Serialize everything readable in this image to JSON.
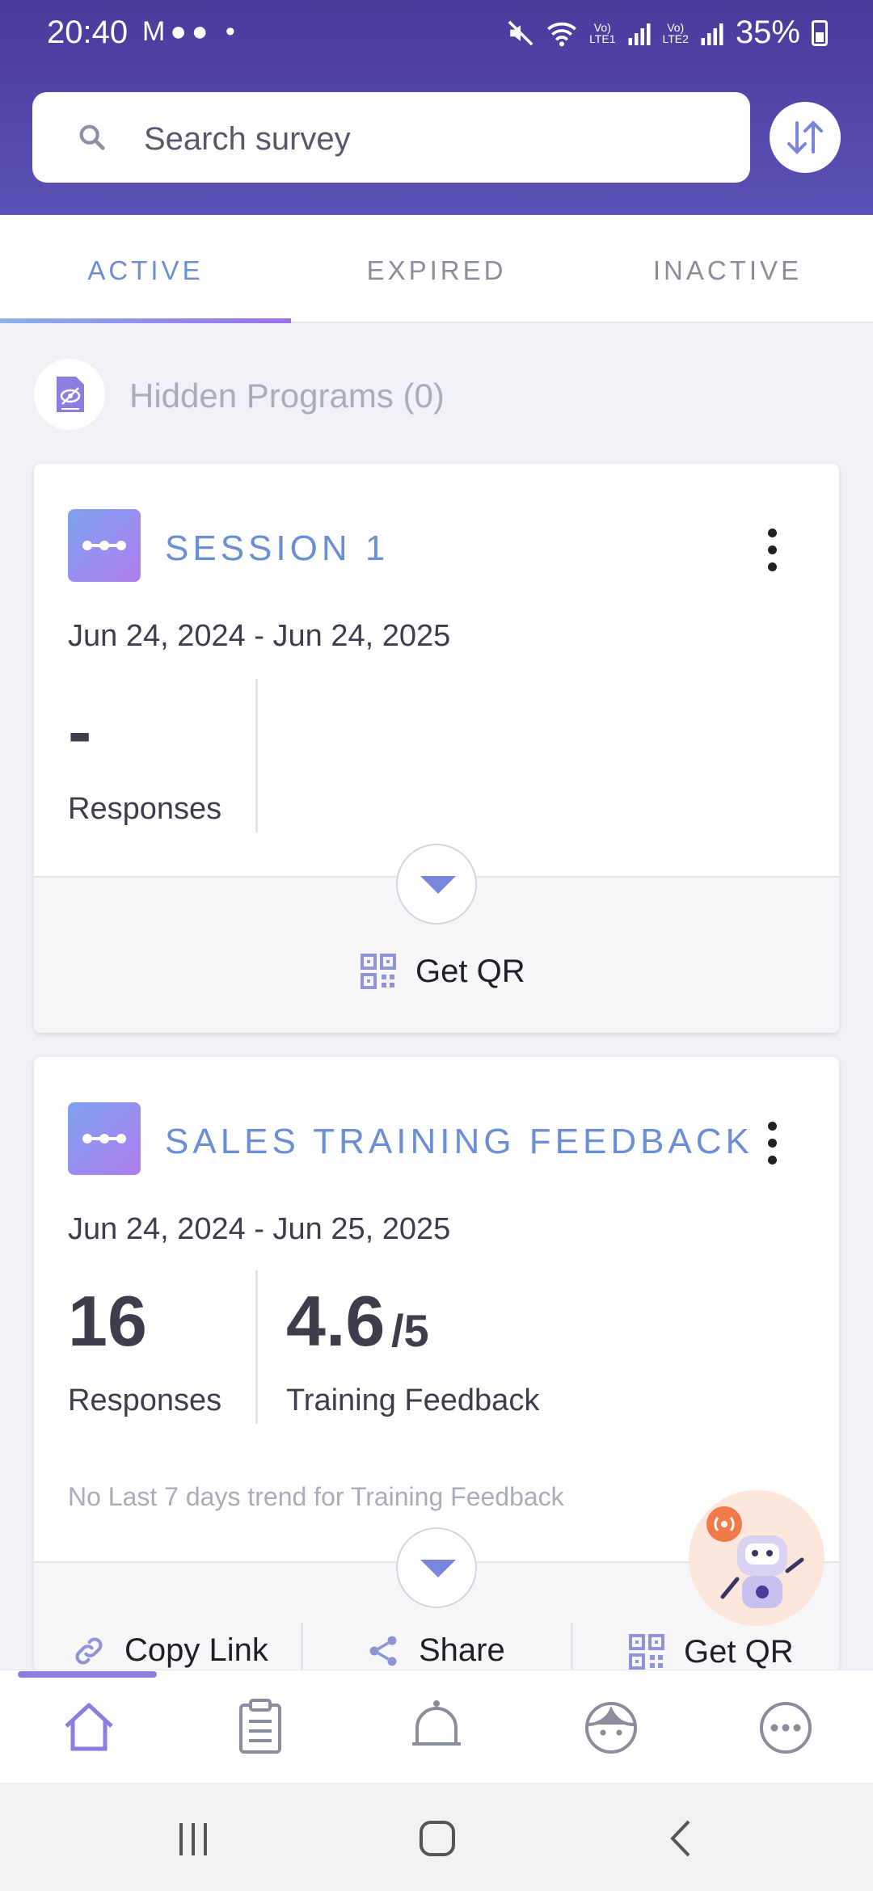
{
  "status_bar": {
    "time": "20:40",
    "left_icons": "M●● •",
    "battery": "35%"
  },
  "search": {
    "placeholder": "Search survey"
  },
  "tabs": [
    {
      "label": "ACTIVE",
      "active": true
    },
    {
      "label": "EXPIRED",
      "active": false
    },
    {
      "label": "INACTIVE",
      "active": false
    }
  ],
  "hidden_programs": {
    "label": "Hidden Programs (0)"
  },
  "cards": [
    {
      "title": "SESSION 1",
      "dates": "Jun 24, 2024 - Jun 24, 2025",
      "responses_value": "-",
      "responses_label": "Responses",
      "actions": [
        {
          "label": "Get QR",
          "icon": "qr-code-icon"
        }
      ]
    },
    {
      "title": "SALES TRAINING FEEDBACK",
      "dates": "Jun 24, 2024 - Jun 25, 2025",
      "responses_value": "16",
      "responses_label": "Responses",
      "score_value": "4.6",
      "score_max": "/5",
      "score_label": "Training Feedback",
      "trend_note": "No Last 7 days trend for Training Feedback",
      "actions": [
        {
          "label": "Copy Link",
          "icon": "link-icon"
        },
        {
          "label": "Share",
          "icon": "share-icon"
        },
        {
          "label": "Get QR",
          "icon": "qr-code-icon"
        }
      ]
    }
  ],
  "bottom_nav": [
    {
      "icon": "home-icon",
      "active": true
    },
    {
      "icon": "clipboard-icon",
      "active": false
    },
    {
      "icon": "bell-icon",
      "active": false
    },
    {
      "icon": "profile-icon",
      "active": false
    },
    {
      "icon": "more-icon",
      "active": false
    }
  ],
  "colors": {
    "header": "#4a3a9c",
    "accent": "#6b8fd4",
    "accent_purple": "#9a6ee8"
  }
}
